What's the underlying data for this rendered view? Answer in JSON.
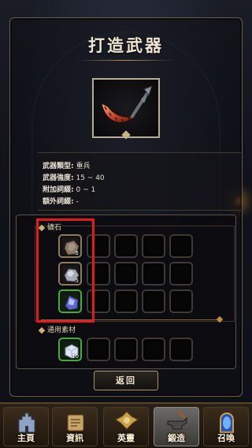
{
  "page": {
    "title": "打造武器"
  },
  "weapon": {
    "type_label": "武器類型:",
    "type_value": "重兵",
    "strength_label": "武器強度:",
    "strength_value": "15 ~ 40",
    "extra_label": "附加詞綴:",
    "extra_value": "0 ~ 1",
    "bonus_label": "額外詞綴:",
    "bonus_value": "-"
  },
  "materials": {
    "ore_label": "礦石",
    "ore_items": [
      {
        "icon": "iron-ore-icon",
        "qty": "5"
      },
      {
        "icon": "silver-ore-icon",
        "qty": "5"
      },
      {
        "icon": "crystal-ore-icon",
        "qty": ""
      }
    ],
    "general_label": "通用素材",
    "general_items": [
      {
        "icon": "ice-cube-icon",
        "qty": "10"
      }
    ]
  },
  "buttons": {
    "back": "返回"
  },
  "nav": {
    "items": [
      {
        "label": "主頁",
        "icon": "castle-icon",
        "active": false
      },
      {
        "label": "資訊",
        "icon": "scroll-icon",
        "active": false
      },
      {
        "label": "英靈",
        "icon": "helmet-icon",
        "active": false
      },
      {
        "label": "鍛造",
        "icon": "anvil-icon",
        "active": true
      },
      {
        "label": "召喚",
        "icon": "portal-icon",
        "active": false
      }
    ]
  },
  "colors": {
    "highlight": "#e11b1b",
    "rarity_green": "#3fae3a",
    "accent_gold": "#b8965a"
  }
}
